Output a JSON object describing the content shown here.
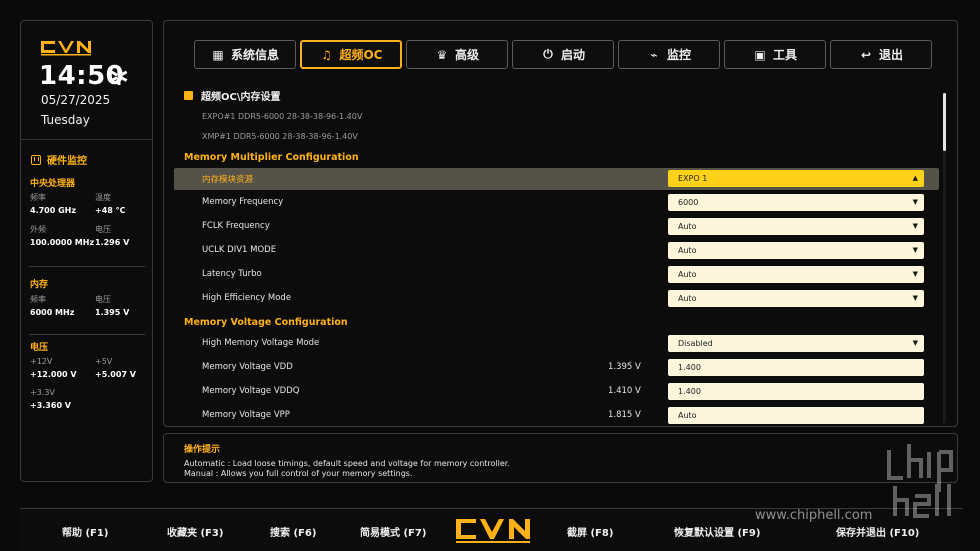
{
  "brand": {
    "name": "CVN"
  },
  "clock": {
    "time": "14:50",
    "date": "05/27/2025",
    "weekday": "Tuesday"
  },
  "monitor": {
    "title": "硬件监控",
    "cpu": {
      "title": "中央处理器",
      "freq_label": "频率",
      "freq": "4.700 GHz",
      "temp_label": "温度",
      "temp": "+48 °C",
      "bclk_label": "外频",
      "bclk": "100.0000 MHz",
      "volt_label": "电压",
      "volt": "1.296 V"
    },
    "memory": {
      "title": "内存",
      "freq_label": "频率",
      "freq": "6000 MHz",
      "volt_label": "电压",
      "volt": "1.395 V"
    },
    "power": {
      "title": "电压",
      "v12_label": "+12V",
      "v12": "+12.000 V",
      "v5_label": "+5V",
      "v5": "+5.007 V",
      "v33_label": "+3.3V",
      "v33": "+3.360 V"
    }
  },
  "tabs": [
    {
      "label": "系统信息",
      "icon": "grid-icon"
    },
    {
      "label": "超频OC",
      "icon": "bell-icon",
      "active": true
    },
    {
      "label": "高级",
      "icon": "crown-icon"
    },
    {
      "label": "启动",
      "icon": "power-icon"
    },
    {
      "label": "监控",
      "icon": "pulse-icon"
    },
    {
      "label": "工具",
      "icon": "toolbox-icon"
    },
    {
      "label": "退出",
      "icon": "back-arrow-icon"
    }
  ],
  "main": {
    "breadcrumb": "超频OC\\内存设置",
    "profiles": [
      "EXPO#1 DDR5-6000 28-38-38-96-1.40V",
      "XMP#1   DDR5-6000 28-38-38-96-1.40V"
    ],
    "group1_title": "Memory Multiplier Configuration",
    "group1": [
      {
        "label": "内存模块资源",
        "value": "EXPO 1",
        "type": "select",
        "selected": true,
        "caret": "▲"
      },
      {
        "label": "Memory Frequency",
        "value": "6000",
        "type": "select",
        "caret": "▼"
      },
      {
        "label": "FCLK Frequency",
        "value": "Auto",
        "type": "select",
        "caret": "▼"
      },
      {
        "label": "UCLK DIV1 MODE",
        "value": "Auto",
        "type": "select",
        "caret": "▼"
      },
      {
        "label": "Latency Turbo",
        "value": "Auto",
        "type": "select",
        "caret": "▼"
      },
      {
        "label": "High Efficiency Mode",
        "value": "Auto",
        "type": "select",
        "caret": "▼"
      }
    ],
    "group2_title": "Memory Voltage Configuration",
    "group2": [
      {
        "label": "High Memory Voltage Mode",
        "value": "Disabled",
        "type": "select",
        "caret": "▼"
      },
      {
        "label": "Memory Voltage VDD",
        "current": "1.395 V",
        "value": "1.400",
        "type": "input"
      },
      {
        "label": "Memory Voltage VDDQ",
        "current": "1.410 V",
        "value": "1.400",
        "type": "input"
      },
      {
        "label": "Memory Voltage VPP",
        "current": "1.815 V",
        "value": "Auto",
        "type": "input"
      }
    ]
  },
  "hints": {
    "title": "操作提示",
    "lines": [
      "Automatic : Load loose timings, default speed and voltage for memory controller.",
      "Manual : Allows you full control of your memory settings."
    ]
  },
  "footer": [
    "帮助 (F1)",
    "收藏夹 (F3)",
    "搜索 (F6)",
    "简易模式 (F7)",
    "截屏 (F8)",
    "恢复默认设置 (F9)",
    "保存并退出 (F10)"
  ],
  "watermark": {
    "text": "www.chiphell.com"
  },
  "colors": {
    "accent": "#ffb11a",
    "field": "#fdf6dc",
    "field_selected": "#ffd21a",
    "bg": "#0a0a0a"
  }
}
